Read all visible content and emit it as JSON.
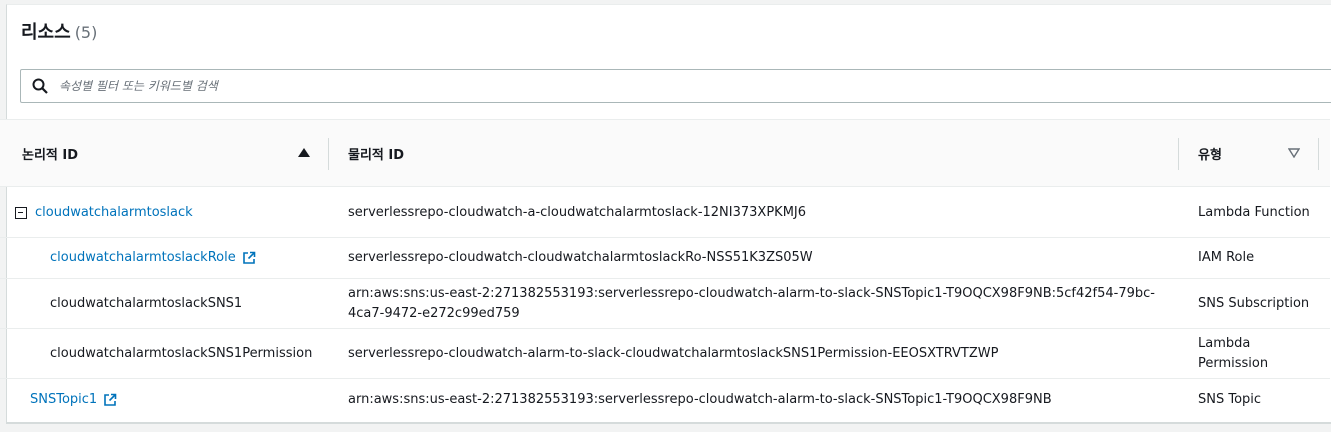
{
  "section": {
    "title": "리소스",
    "count": "(5)"
  },
  "search": {
    "placeholder": "속성별 필터 또는 키워드별 검색"
  },
  "table": {
    "headers": {
      "logical_id": "논리적 ID",
      "physical_id": "물리적 ID",
      "type": "유형"
    },
    "rows": [
      {
        "logical_id": "cloudwatchalarmtoslack",
        "physical_id": "serverlessrepo-cloudwatch-a-cloudwatchalarmtoslack-12NI373XPKMJ6",
        "type": "Lambda Function"
      },
      {
        "logical_id": "cloudwatchalarmtoslackRole",
        "physical_id": "serverlessrepo-cloudwatch-cloudwatchalarmtoslackRo-NSS51K3ZS05W",
        "type": "IAM Role"
      },
      {
        "logical_id": "cloudwatchalarmtoslackSNS1",
        "physical_id": "arn:aws:sns:us-east-2:271382553193:serverlessrepo-cloudwatch-alarm-to-slack-SNSTopic1-T9OQCX98F9NB:5cf42f54-79bc-4ca7-9472-e272c99ed759",
        "type": "SNS Subscription"
      },
      {
        "logical_id": "cloudwatchalarmtoslackSNS1Permission",
        "physical_id": "serverlessrepo-cloudwatch-alarm-to-slack-cloudwatchalarmtoslackSNS1Permission-EEOSXTRVTZWP",
        "type": "Lambda Permission"
      },
      {
        "logical_id": "SNSTopic1",
        "physical_id": "arn:aws:sns:us-east-2:271382553193:serverlessrepo-cloudwatch-alarm-to-slack-SNSTopic1-T9OQCX98F9NB",
        "type": "SNS Topic"
      }
    ]
  },
  "colors": {
    "link": "#0073bb",
    "text": "#16191f",
    "border": "#eaeded"
  }
}
